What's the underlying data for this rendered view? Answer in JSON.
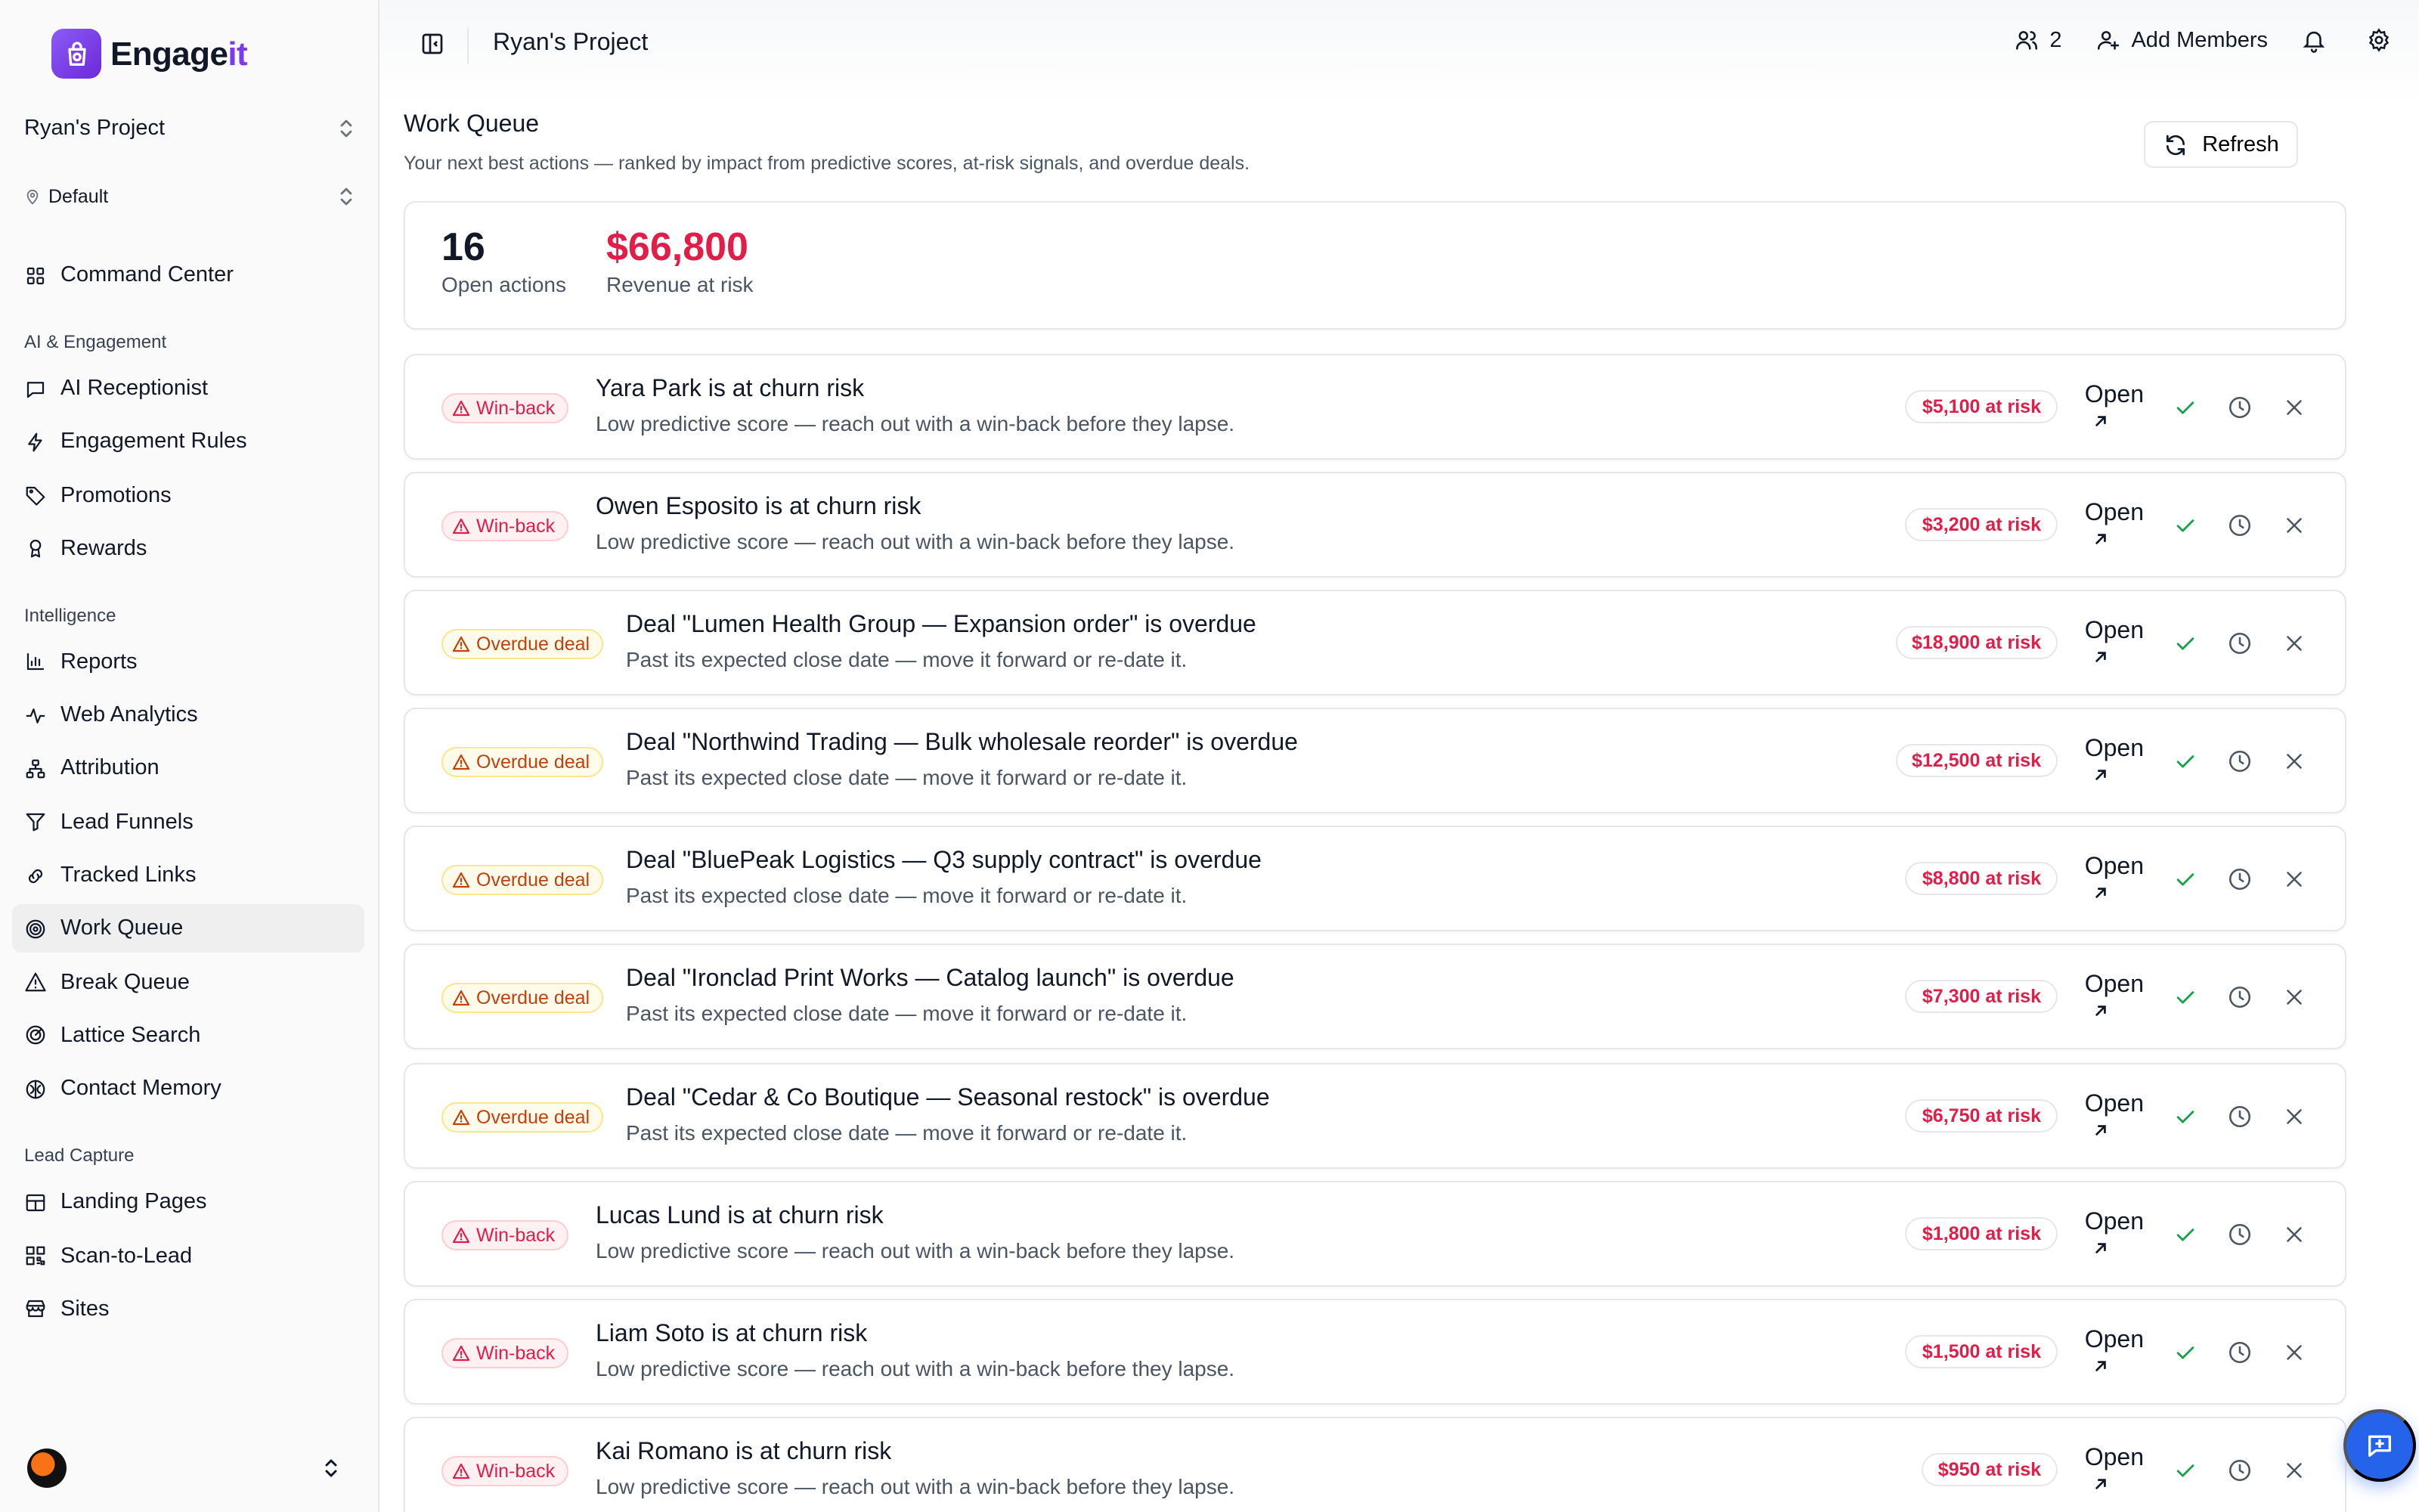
{
  "sidebar": {
    "brand": {
      "main": "Engage",
      "accent": "it"
    },
    "project": "Ryan's Project",
    "location": "Default",
    "top_items": [
      {
        "label": "Command Center",
        "icon": "grid-icon"
      }
    ],
    "sections": [
      {
        "label": "AI & Engagement",
        "items": [
          {
            "label": "AI Receptionist",
            "icon": "message-icon"
          },
          {
            "label": "Engagement Rules",
            "icon": "bolt-icon"
          },
          {
            "label": "Promotions",
            "icon": "tag-icon"
          },
          {
            "label": "Rewards",
            "icon": "award-icon"
          }
        ]
      },
      {
        "label": "Intelligence",
        "items": [
          {
            "label": "Reports",
            "icon": "bar-chart-icon"
          },
          {
            "label": "Web Analytics",
            "icon": "activity-icon"
          },
          {
            "label": "Attribution",
            "icon": "network-icon"
          },
          {
            "label": "Lead Funnels",
            "icon": "filter-icon"
          },
          {
            "label": "Tracked Links",
            "icon": "link-icon"
          },
          {
            "label": "Work Queue",
            "icon": "target-icon",
            "active": true
          },
          {
            "label": "Break Queue",
            "icon": "alert-triangle-icon"
          },
          {
            "label": "Lattice Search",
            "icon": "radar-icon"
          },
          {
            "label": "Contact Memory",
            "icon": "brain-icon"
          }
        ]
      },
      {
        "label": "Lead Capture",
        "items": [
          {
            "label": "Landing Pages",
            "icon": "layout-icon"
          },
          {
            "label": "Scan-to-Lead",
            "icon": "qr-code-icon"
          },
          {
            "label": "Sites",
            "icon": "store-icon"
          }
        ]
      }
    ]
  },
  "topbar": {
    "title": "Ryan's Project",
    "members_count": "2",
    "add_members": "Add Members"
  },
  "page": {
    "title": "Work Queue",
    "subtitle": "Your next best actions — ranked by impact from predictive scores, at-risk signals, and overdue deals.",
    "refresh_label": "Refresh"
  },
  "stats": {
    "open_actions": {
      "value": "16",
      "label": "Open actions"
    },
    "revenue_at_risk": {
      "value": "$66,800",
      "label": "Revenue at risk"
    }
  },
  "open_label": "Open",
  "colors": {
    "risk": "#e11d48",
    "winback": "#e11d48",
    "overdue": "#c2410c",
    "accent": "#7c3aed",
    "fab": "#2563eb"
  },
  "items": [
    {
      "type": "winback",
      "badge": "Win-back",
      "title": "Yara Park is at churn risk",
      "subtitle": "Low predictive score — reach out with a win-back before they lapse.",
      "risk": "$5,100 at risk"
    },
    {
      "type": "winback",
      "badge": "Win-back",
      "title": "Owen Esposito is at churn risk",
      "subtitle": "Low predictive score — reach out with a win-back before they lapse.",
      "risk": "$3,200 at risk"
    },
    {
      "type": "overdue",
      "badge": "Overdue deal",
      "title": "Deal \"Lumen Health Group — Expansion order\" is overdue",
      "subtitle": "Past its expected close date — move it forward or re-date it.",
      "risk": "$18,900 at risk"
    },
    {
      "type": "overdue",
      "badge": "Overdue deal",
      "title": "Deal \"Northwind Trading — Bulk wholesale reorder\" is overdue",
      "subtitle": "Past its expected close date — move it forward or re-date it.",
      "risk": "$12,500 at risk"
    },
    {
      "type": "overdue",
      "badge": "Overdue deal",
      "title": "Deal \"BluePeak Logistics — Q3 supply contract\" is overdue",
      "subtitle": "Past its expected close date — move it forward or re-date it.",
      "risk": "$8,800 at risk"
    },
    {
      "type": "overdue",
      "badge": "Overdue deal",
      "title": "Deal \"Ironclad Print Works — Catalog launch\" is overdue",
      "subtitle": "Past its expected close date — move it forward or re-date it.",
      "risk": "$7,300 at risk"
    },
    {
      "type": "overdue",
      "badge": "Overdue deal",
      "title": "Deal \"Cedar & Co Boutique — Seasonal restock\" is overdue",
      "subtitle": "Past its expected close date — move it forward or re-date it.",
      "risk": "$6,750 at risk"
    },
    {
      "type": "winback",
      "badge": "Win-back",
      "title": "Lucas Lund is at churn risk",
      "subtitle": "Low predictive score — reach out with a win-back before they lapse.",
      "risk": "$1,800 at risk"
    },
    {
      "type": "winback",
      "badge": "Win-back",
      "title": "Liam Soto is at churn risk",
      "subtitle": "Low predictive score — reach out with a win-back before they lapse.",
      "risk": "$1,500 at risk"
    },
    {
      "type": "winback",
      "badge": "Win-back",
      "title": "Kai Romano is at churn risk",
      "subtitle": "Low predictive score — reach out with a win-back before they lapse.",
      "risk": "$950 at risk"
    }
  ]
}
